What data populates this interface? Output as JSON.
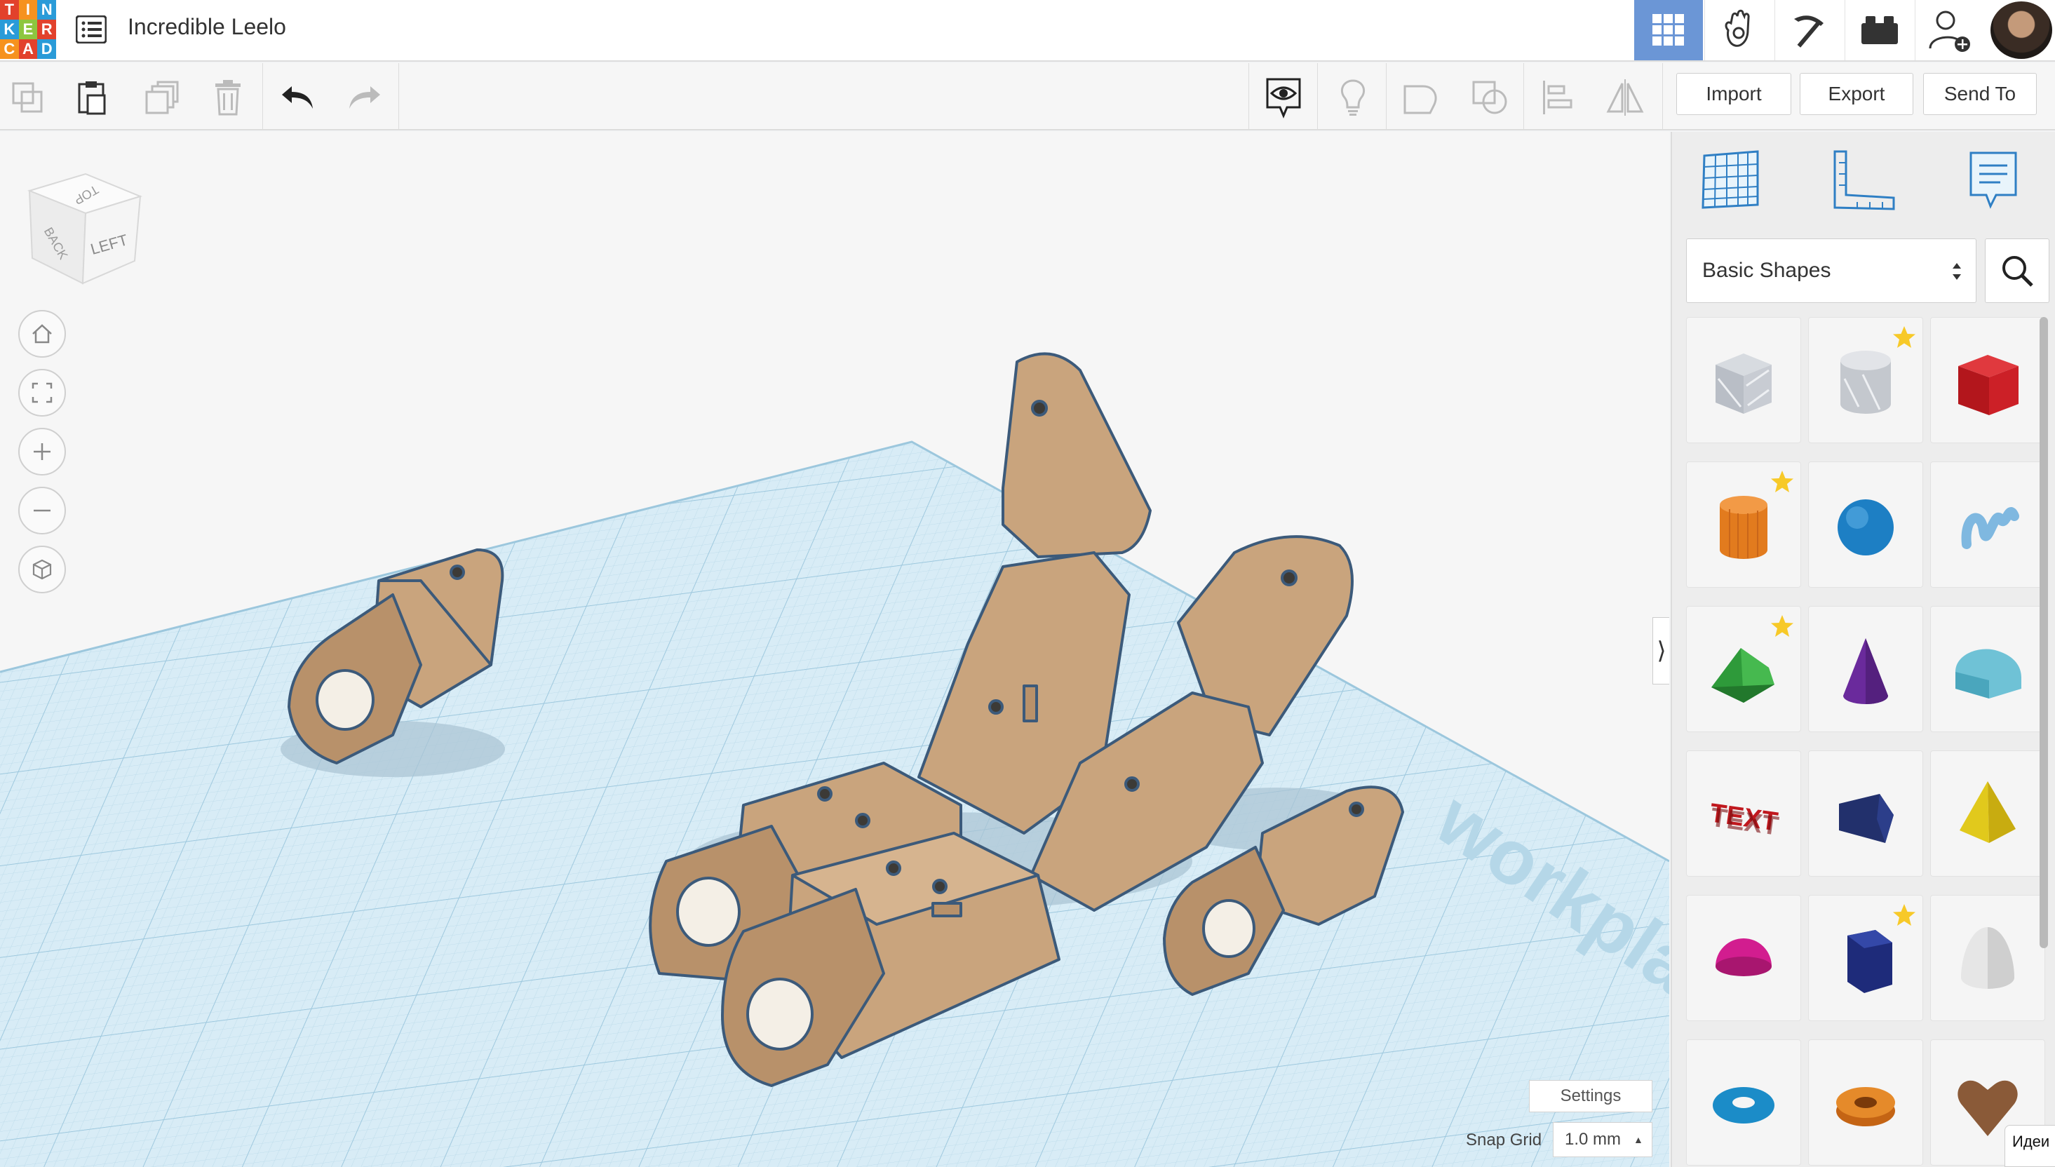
{
  "app": {
    "logo_letters": [
      "T",
      "I",
      "N",
      "K",
      "E",
      "R",
      "C",
      "A",
      "D"
    ],
    "logo_colors": [
      "#e2412c",
      "#f6921e",
      "#2a9bd8",
      "#2a9bd8",
      "#8dc63f",
      "#e2412c",
      "#f6921e",
      "#e2412c",
      "#2a9bd8"
    ],
    "document_title": "Incredible Leelo"
  },
  "top_nav": {
    "items": [
      {
        "name": "3d-design-grid-icon",
        "active": true
      },
      {
        "name": "circuits-hand-icon",
        "active": false
      },
      {
        "name": "minecraft-pickaxe-icon",
        "active": false
      },
      {
        "name": "lego-brick-icon",
        "active": false
      },
      {
        "name": "add-user-icon",
        "active": false
      }
    ],
    "active_color": "#6b96d6"
  },
  "toolbar": {
    "import_label": "Import",
    "export_label": "Export",
    "send_to_label": "Send To"
  },
  "viewcube": {
    "face_left": "LEFT",
    "face_back": "BACK",
    "face_top": "TOP"
  },
  "viewport": {
    "settings_label": "Settings",
    "snap_grid_label": "Snap Grid",
    "snap_grid_value": "1.0 mm",
    "watermark": "workplan"
  },
  "panel": {
    "shape_category": "Basic Shapes",
    "shapes": [
      {
        "name": "box-hole",
        "starred": false
      },
      {
        "name": "cylinder-hole",
        "starred": true
      },
      {
        "name": "box",
        "starred": false
      },
      {
        "name": "cylinder",
        "starred": true
      },
      {
        "name": "sphere",
        "starred": false
      },
      {
        "name": "scribble",
        "starred": false
      },
      {
        "name": "roof",
        "starred": true
      },
      {
        "name": "cone",
        "starred": false
      },
      {
        "name": "round-roof",
        "starred": false
      },
      {
        "name": "text",
        "starred": false
      },
      {
        "name": "wedge",
        "starred": false
      },
      {
        "name": "pyramid",
        "starred": false
      },
      {
        "name": "half-sphere",
        "starred": false
      },
      {
        "name": "polygon",
        "starred": true
      },
      {
        "name": "paraboloid",
        "starred": false
      },
      {
        "name": "torus",
        "starred": false
      },
      {
        "name": "tube",
        "starred": false
      },
      {
        "name": "heart",
        "starred": false
      }
    ],
    "ideas_label": "Идеи"
  },
  "colors": {
    "part": "#c9a47d",
    "part_edge": "#3c5a7a",
    "grid": "#cfe6f2",
    "star": "#f7c928"
  }
}
